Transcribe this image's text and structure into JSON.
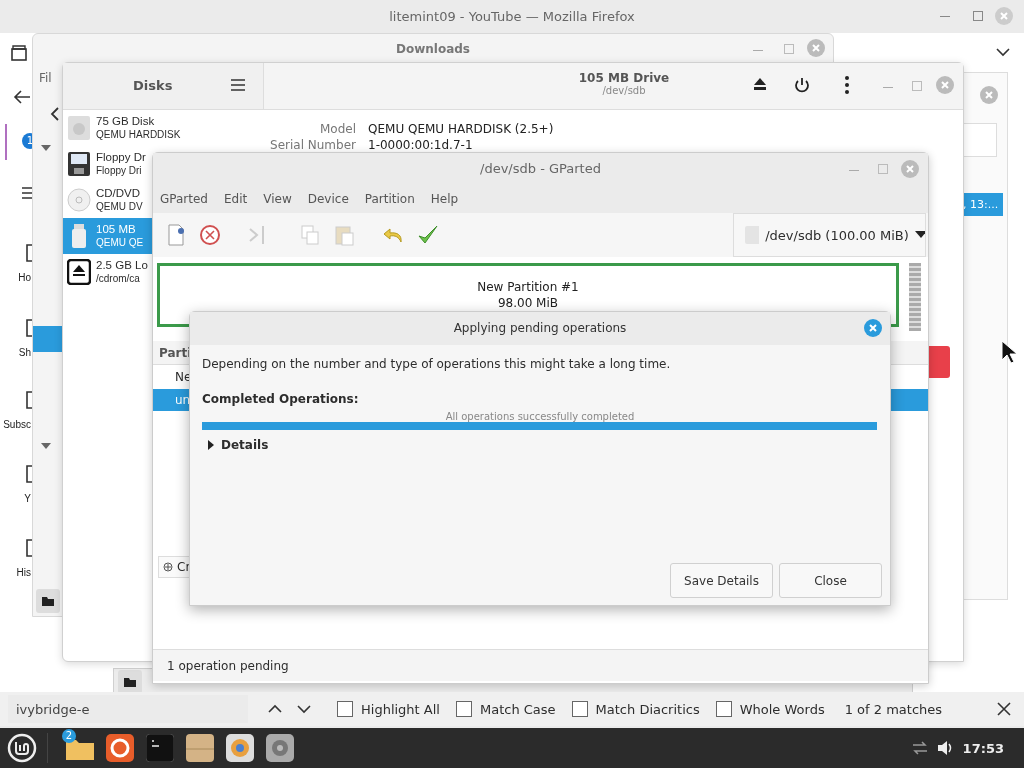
{
  "firefox": {
    "title": "litemint09 - YouTube — Mozilla Firefox",
    "notification_badge": "1",
    "sidebar_labels": [
      "Ho",
      "Sh",
      "Subsc",
      "Y",
      "His"
    ],
    "list_row_text": ", 13:..."
  },
  "downloads": {
    "title": "Downloads",
    "menu_text": "Fil"
  },
  "disks": {
    "title": "Disks",
    "drive_title": "105 MB Drive",
    "drive_subtitle": "/dev/sdb",
    "devices": [
      {
        "kind": "hdd",
        "name": "75 GB Disk",
        "detail": "QEMU HARDDISK",
        "selected": false
      },
      {
        "kind": "floppy",
        "name": "Floppy Dr",
        "detail": "Floppy Dri",
        "selected": false
      },
      {
        "kind": "optical",
        "name": "CD/DVD",
        "detail": "QEMU DV",
        "selected": false
      },
      {
        "kind": "usb",
        "name": "105 MB",
        "detail": "QEMU QE",
        "selected": true
      },
      {
        "kind": "image",
        "name": "2.5 GB Lo",
        "detail": "/cdrom/ca",
        "selected": false
      }
    ],
    "properties": [
      {
        "label": "Model",
        "value": "QEMU QEMU HARDDISK (2.5+)"
      },
      {
        "label": "Serial Number",
        "value": "1-0000:00:1d.7-1"
      }
    ]
  },
  "gparted": {
    "title": "/dev/sdb - GParted",
    "menu": [
      "GParted",
      "Edit",
      "View",
      "Device",
      "Partition",
      "Help"
    ],
    "device": "/dev/sdb (100.00 MiB)",
    "partition": {
      "name": "New Partition #1",
      "size": "98.00 MiB"
    },
    "table_header": "Parti",
    "rows": [
      {
        "text": "Ne",
        "selected": false
      },
      {
        "text": "un",
        "selected": true
      }
    ],
    "create_text": "Cr",
    "status": "1 operation pending"
  },
  "dialog": {
    "title": "Applying pending operations",
    "message": "Depending on the number and type of operations this might take a long time.",
    "completed_label": "Completed Operations:",
    "progress": {
      "level": 1,
      "text": "All operations successfully completed"
    },
    "details": {
      "label": "Details",
      "expanded": false
    },
    "buttons": [
      "Save Details",
      "Close"
    ]
  },
  "find_bar": {
    "value": "ivybridge-e",
    "options": [
      {
        "label": "Highlight All",
        "checked": false
      },
      {
        "label": "Match Case",
        "checked": false
      },
      {
        "label": "Match Diacritics",
        "checked": false
      },
      {
        "label": "Whole Words",
        "checked": false
      }
    ],
    "matches": "1 of 2 matches"
  },
  "taskbar": {
    "files_badge": "2",
    "clock": "17:53"
  }
}
